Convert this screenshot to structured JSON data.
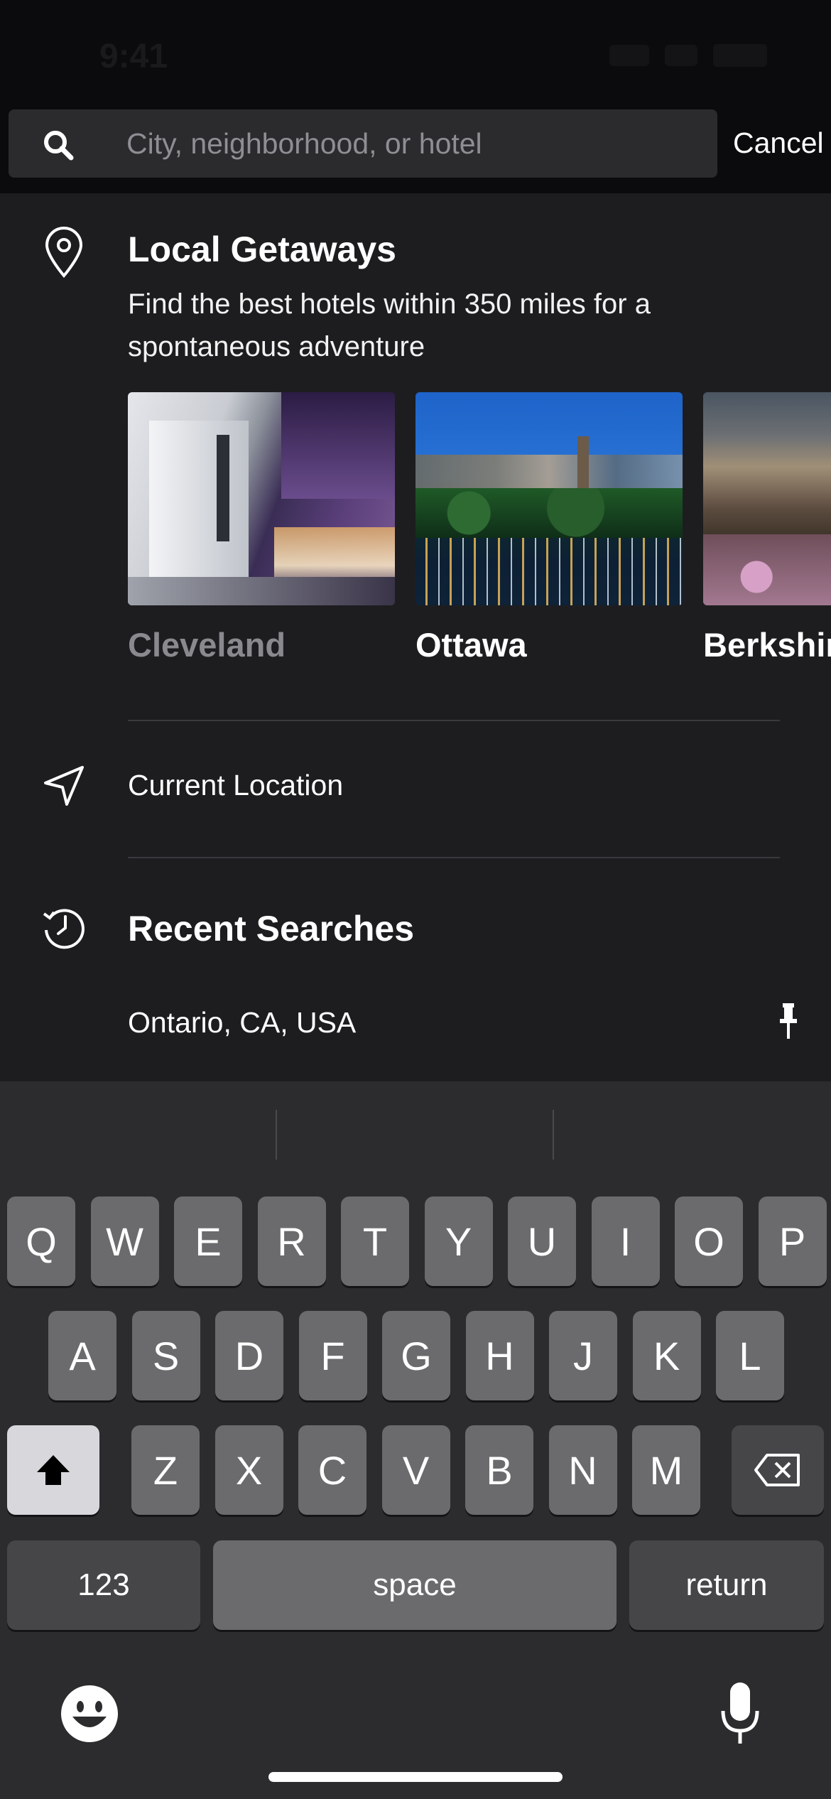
{
  "status_bar": {
    "time": "9:41"
  },
  "search": {
    "placeholder": "City, neighborhood, or hotel",
    "cancel_label": "Cancel"
  },
  "local_getaways": {
    "title": "Local Getaways",
    "description": "Find the best hotels within 350 miles for a spontaneous adventure",
    "destinations": [
      {
        "name": "Cleveland"
      },
      {
        "name": "Ottawa"
      },
      {
        "name": "Berkshir"
      }
    ]
  },
  "current_location": {
    "label": "Current Location"
  },
  "recent_searches": {
    "title": "Recent Searches",
    "items": [
      {
        "label": "Ontario, CA, USA"
      }
    ]
  },
  "keyboard": {
    "row1": [
      "Q",
      "W",
      "E",
      "R",
      "T",
      "Y",
      "U",
      "I",
      "O",
      "P"
    ],
    "row2": [
      "A",
      "S",
      "D",
      "F",
      "G",
      "H",
      "J",
      "K",
      "L"
    ],
    "row3": [
      "Z",
      "X",
      "C",
      "V",
      "B",
      "N",
      "M"
    ],
    "numbers_label": "123",
    "space_label": "space",
    "return_label": "return"
  }
}
